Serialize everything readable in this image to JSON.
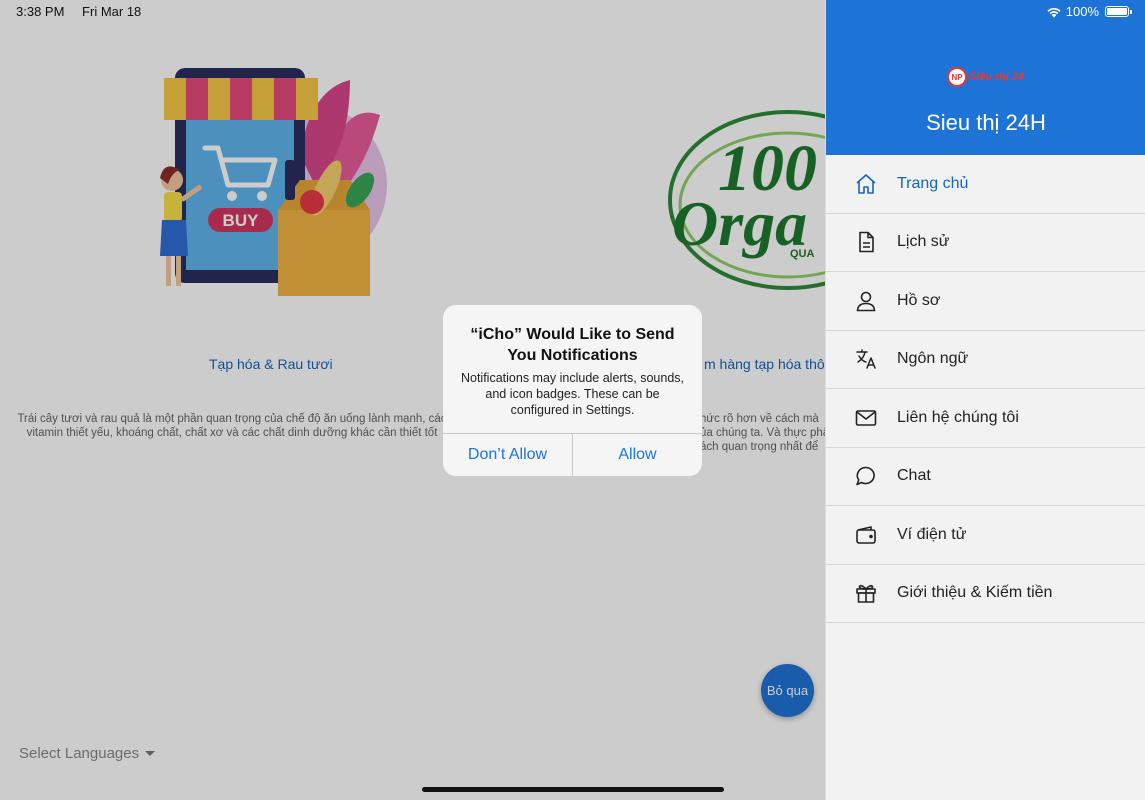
{
  "status_bar": {
    "time": "3:38 PM",
    "date": "Fri Mar 18",
    "battery": "100%"
  },
  "onboarding": {
    "slide1_title": "Tạp hóa & Rau tươi",
    "slide1_desc": "Trái cây tươi và rau quả là một phần quan trọng của chế độ ăn uống lành mạnh, các vitamin thiết yếu, khoáng chất, chất xơ và các chất dinh dưỡng khác cần thiết tốt",
    "slide1_badge": "BUY",
    "slide2_title_partial": "m hàng tạp hóa thô",
    "slide2_desc_partial": "hức rõ hơn về cách mà\nủa chúng ta. Và thực phẩ\nách quan trọng nhất để",
    "slide2_logo_top": "100",
    "slide2_logo_mid": "Orga",
    "slide2_logo_small": "QUA",
    "skip_label": "Bỏ qua",
    "language_select": "Select Languages"
  },
  "drawer": {
    "logo_text": "Siêu thị 24",
    "title": "Sieu thị 24H",
    "items": [
      {
        "label": "Trang chủ",
        "icon": "home-icon"
      },
      {
        "label": "Lịch sử",
        "icon": "document-icon"
      },
      {
        "label": "Hồ sơ",
        "icon": "user-icon"
      },
      {
        "label": "Ngôn ngữ",
        "icon": "translate-icon"
      },
      {
        "label": "Liên hệ chúng tôi",
        "icon": "mail-icon"
      },
      {
        "label": "Chat",
        "icon": "chat-icon"
      },
      {
        "label": "Ví điện tử",
        "icon": "wallet-icon"
      },
      {
        "label": "Giới thiệu & Kiếm tiền",
        "icon": "gift-icon"
      }
    ]
  },
  "alert": {
    "title": "“iCho” Would Like to Send You Notifications",
    "message": "Notifications may include alerts, sounds, and icon badges. These can be configured in Settings.",
    "deny_label": "Don’t Allow",
    "allow_label": "Allow"
  },
  "colors": {
    "primary": "#1e73d6",
    "link": "#1565c0",
    "drawer_bg": "#f2f2f2"
  }
}
